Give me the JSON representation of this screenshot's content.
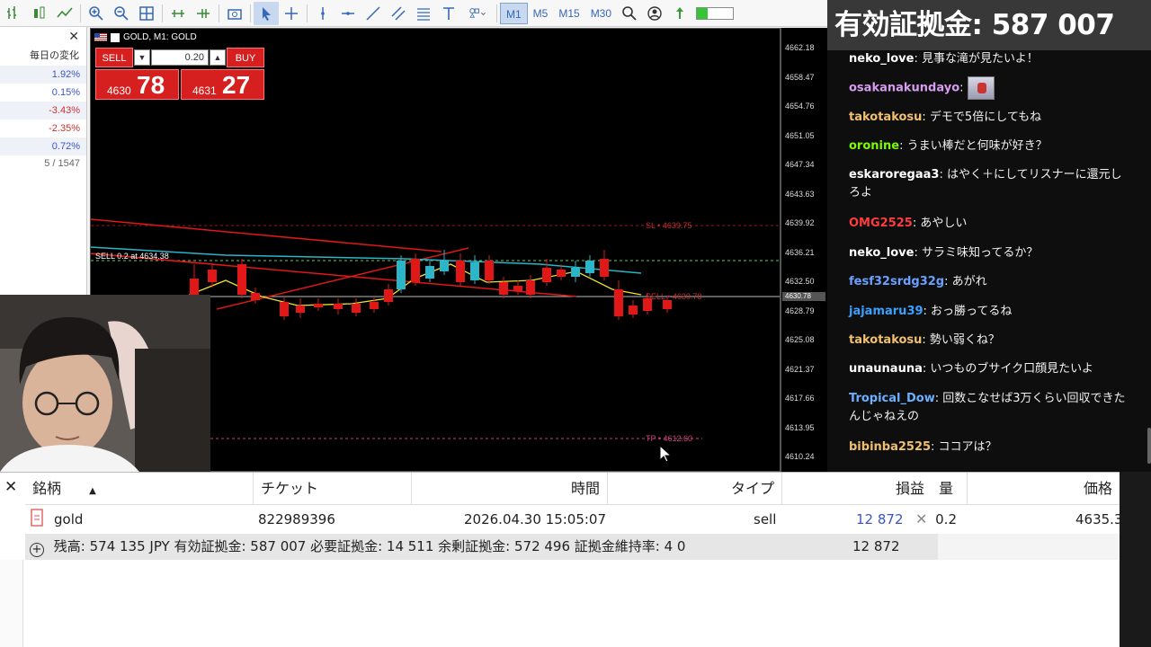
{
  "toolbar": {
    "timeframes": [
      "M1",
      "M5",
      "M15",
      "M30"
    ],
    "active_timeframe": "M1",
    "connection_fill": 0.3
  },
  "watchlist": {
    "header": "毎日の変化",
    "rows": [
      {
        "value": "1.92%",
        "color": "#3a55c8"
      },
      {
        "value": "0.15%",
        "color": "#3a55c8"
      },
      {
        "value": "-3.43%",
        "color": "#d03030"
      },
      {
        "value": "-2.35%",
        "color": "#d03030"
      },
      {
        "value": "0.72%",
        "color": "#3a55c8"
      }
    ],
    "count": "5 / 1547"
  },
  "chart": {
    "title": "GOLD, M1:  GOLD",
    "sell_label": "SELL",
    "buy_label": "BUY",
    "volume": "0.20",
    "sell_price_small": "4630",
    "sell_price_big": "78",
    "buy_price_small": "4631",
    "buy_price_big": "27",
    "axis_ticks": [
      "4662.18",
      "4658.47",
      "4654.76",
      "4651.05",
      "4647.34",
      "4643.63",
      "4639.92",
      "4636.21",
      "4632.50",
      "4628.79",
      "4625.08",
      "4621.37",
      "4617.66",
      "4613.95",
      "4610.24"
    ],
    "current_price_tag": "4630.78",
    "sl_label": "SL • 4639.75",
    "entry_label": "SELL 0.2 at 4634.38",
    "sell_line_label": "SELL • 4630.78",
    "tp_label": "TP • 4612.60",
    "colors": {
      "bear": "#e01818",
      "bull": "#2ab5c8",
      "ma": "#f0e030",
      "trend": "#e01818"
    }
  },
  "chat": {
    "amount_banner": "有効証拠金: 587 007",
    "messages": [
      {
        "user": "neko_love",
        "text": ": 見事な滝が見たいよ！",
        "color": "#ffffff"
      },
      {
        "user": "osakanakundayo",
        "text": ":",
        "color": "#d59cf0",
        "emote": true
      },
      {
        "user": "takotakosu",
        "text": ": デモで5倍にしてもね",
        "color": "#f0c070"
      },
      {
        "user": "oronine",
        "text": ": うまい棒だと何味が好き？",
        "color": "#7cfc00"
      },
      {
        "user": "eskaroregaa3",
        "text": ": はやく＋にしてリスナーに還元しろよ",
        "color": "#ffffff"
      },
      {
        "user": "OMG2525",
        "text": ": あやしい",
        "color": "#ff3b3b"
      },
      {
        "user": "neko_love",
        "text": ": サラミ味知ってるか？",
        "color": "#ffffff"
      },
      {
        "user": "fesf32srdg32g",
        "text": ": あがれ",
        "color": "#6aa0ff"
      },
      {
        "user": "jajamaru39",
        "text": ": おっ勝ってるね",
        "color": "#3aa0ff"
      },
      {
        "user": "takotakosu",
        "text": ": 勢い弱くね？",
        "color": "#f0c070"
      },
      {
        "user": "unaunauna",
        "text": ": いつものブサイク口顔見たいよ",
        "color": "#ffffff"
      },
      {
        "user": "Tropical_Dow",
        "text": ": 回数こなせば3万くらい回収できたんじゃねえの",
        "color": "#6ab0ff"
      },
      {
        "user": "bibinba2525",
        "text": ": ココアは？",
        "color": "#f0c070"
      }
    ]
  },
  "trade": {
    "headers": {
      "symbol": "銘柄",
      "ticket": "チケット",
      "time": "時間",
      "type": "タイプ",
      "profit": "損益",
      "volume": "量",
      "price": "価格"
    },
    "row": {
      "symbol": "gold",
      "ticket": "822989396",
      "time": "2026.04.30 15:05:07",
      "type": "sell",
      "profit": "12 872",
      "volume": "0.2",
      "price": "4635.3"
    },
    "summary": "残高: 574 135 JPY  有効証拠金: 587 007  必要証拠金: 14 511  余剰証拠金: 572 496  証拠金維持率: 4 0",
    "summary_profit": "12 872"
  }
}
